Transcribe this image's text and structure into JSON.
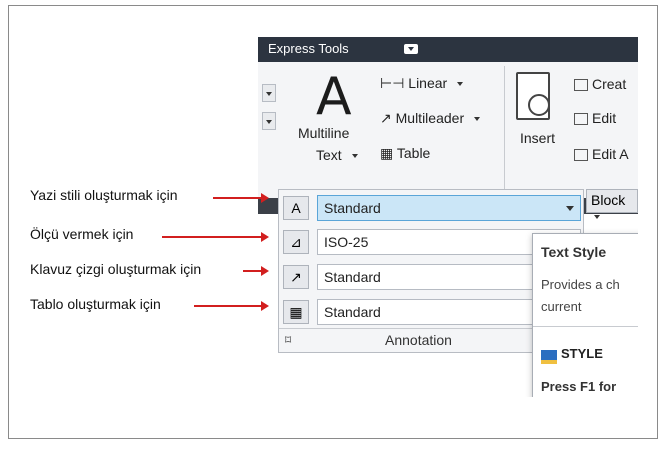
{
  "ribbon": {
    "tab_title": "Express Tools",
    "text_button": {
      "line1": "Multiline",
      "line2": "Text",
      "big_glyph": "A"
    },
    "options": {
      "linear": "Linear",
      "multileader": "Multileader",
      "table": "Table"
    },
    "insert_label": "Insert",
    "block_items": {
      "create": "Creat",
      "edit": "Edit",
      "edit_attr": "Edit A"
    },
    "block_dropdown": "Block"
  },
  "annotation": {
    "rows": [
      {
        "value": "Standard",
        "icon": "text-style-icon"
      },
      {
        "value": "ISO-25",
        "icon": "dimension-style-icon"
      },
      {
        "value": "Standard",
        "icon": "multileader-style-icon"
      },
      {
        "value": "Standard",
        "icon": "table-style-icon"
      }
    ],
    "footer": "Annotation"
  },
  "tooltip": {
    "title": "Text Style",
    "description": "Provides a ch current",
    "command": "STYLE",
    "help": "Press F1 for"
  },
  "callouts": [
    "Yazi stili oluşturmak için",
    "Ölçü vermek için",
    "Klavuz çizgi oluşturmak için",
    "Tablo oluşturmak için"
  ],
  "colors": {
    "titlebar": "#2c3440",
    "arrow": "#d21f1f",
    "selected_combo": "#cbe6f7"
  }
}
